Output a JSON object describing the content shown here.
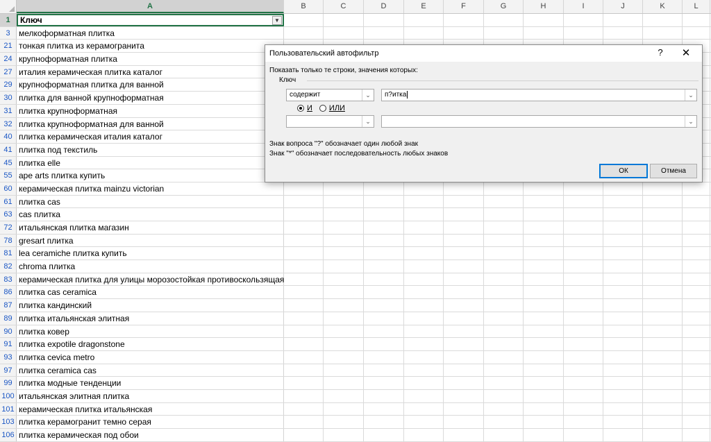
{
  "sheet": {
    "columns": [
      "A",
      "B",
      "C",
      "D",
      "E",
      "F",
      "G",
      "H",
      "I",
      "J",
      "K",
      "L"
    ],
    "header_cell": "Ключ",
    "rows": [
      {
        "num": "1",
        "text": "Ключ"
      },
      {
        "num": "3",
        "text": "мелкоформатная плитка"
      },
      {
        "num": "21",
        "text": "тонкая плитка из керамогранита"
      },
      {
        "num": "24",
        "text": "крупноформатная плитка"
      },
      {
        "num": "27",
        "text": "италия керамическая плитка каталог"
      },
      {
        "num": "29",
        "text": "крупноформатная плитка для ванной"
      },
      {
        "num": "30",
        "text": "плитка для ванной крупноформатная"
      },
      {
        "num": "31",
        "text": "плитка крупноформатная"
      },
      {
        "num": "32",
        "text": "плитка крупноформатная для ванной"
      },
      {
        "num": "40",
        "text": "плитка керамическая италия каталог"
      },
      {
        "num": "41",
        "text": "плитка под текстиль"
      },
      {
        "num": "45",
        "text": "плитка elle"
      },
      {
        "num": "55",
        "text": "ape arts плитка купить"
      },
      {
        "num": "60",
        "text": "керамическая плитка mainzu victorian"
      },
      {
        "num": "61",
        "text": "плитка cas"
      },
      {
        "num": "63",
        "text": "cas плитка"
      },
      {
        "num": "72",
        "text": "итальянская плитка магазин"
      },
      {
        "num": "78",
        "text": "gresart плитка"
      },
      {
        "num": "81",
        "text": "lea ceramiche плитка купить"
      },
      {
        "num": "82",
        "text": "chroma плитка"
      },
      {
        "num": "83",
        "text": "керамическая плитка для улицы морозостойкая противоскользящая"
      },
      {
        "num": "86",
        "text": "плитка cas ceramica"
      },
      {
        "num": "87",
        "text": "плитка кандинский"
      },
      {
        "num": "89",
        "text": "плитка итальянская элитная"
      },
      {
        "num": "90",
        "text": "плитка ковер"
      },
      {
        "num": "91",
        "text": "плитка expotile dragonstone"
      },
      {
        "num": "93",
        "text": "плитка cevica metro"
      },
      {
        "num": "97",
        "text": "плитка ceramica cas"
      },
      {
        "num": "99",
        "text": "плитка модные тенденции"
      },
      {
        "num": "100",
        "text": "итальянская элитная плитка"
      },
      {
        "num": "101",
        "text": "керамическая плитка итальянская"
      },
      {
        "num": "103",
        "text": "плитка керамогранит темно серая"
      },
      {
        "num": "106",
        "text": "плитка керамическая под обои"
      }
    ]
  },
  "dialog": {
    "title": "Пользовательский автофильтр",
    "help": "?",
    "close": "✕",
    "prompt": "Показать только те строки, значения которых:",
    "field": "Ключ",
    "op1": "содержит",
    "val1": "п?итка",
    "and_label": "И",
    "or_label": "ИЛИ",
    "op2": "",
    "val2": "",
    "hint1": "Знак вопроса \"?\" обозначает один любой знак",
    "hint2": "Знак \"*\" обозначает последовательность любых знаков",
    "ok": "ОК",
    "cancel": "Отмена"
  }
}
